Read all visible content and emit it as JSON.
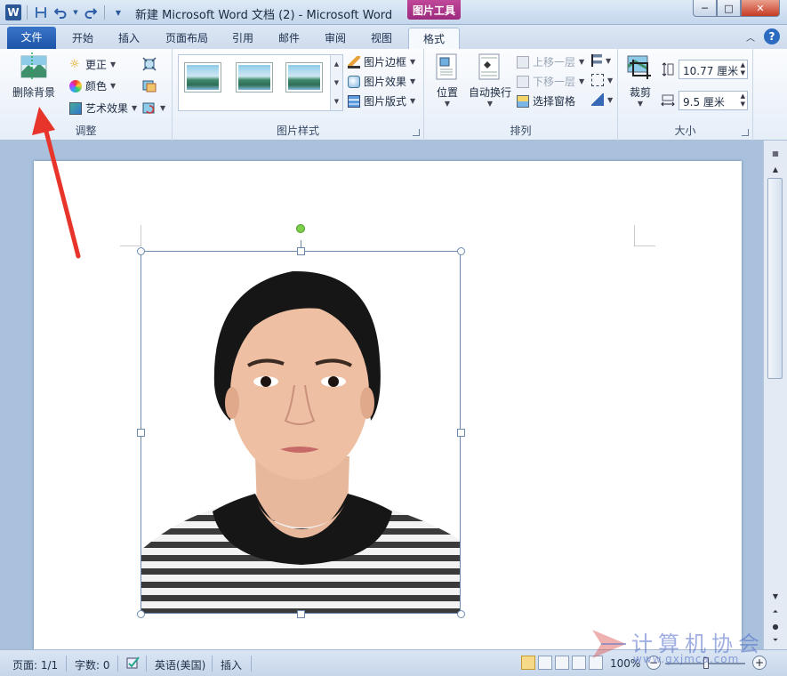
{
  "window": {
    "title": "新建 Microsoft Word 文档 (2)  -  Microsoft Word",
    "context_tab_title": "图片工具",
    "controls": {
      "minimize": "─",
      "maximize": "□",
      "close": "✕"
    }
  },
  "qat": {
    "logo": "W",
    "icons": [
      "save-icon",
      "undo-icon",
      "redo-icon",
      "customize-icon"
    ]
  },
  "tabs": [
    {
      "label": "文件",
      "kind": "file"
    },
    {
      "label": "开始"
    },
    {
      "label": "插入"
    },
    {
      "label": "页面布局"
    },
    {
      "label": "引用"
    },
    {
      "label": "邮件"
    },
    {
      "label": "审阅"
    },
    {
      "label": "视图"
    },
    {
      "label": "格式",
      "active": true
    }
  ],
  "help": "?",
  "ribbon": {
    "adjust": {
      "label": "调整",
      "remove_bg": "删除背景",
      "corrections": "更正",
      "color": "颜色",
      "artistic": "艺术效果"
    },
    "styles": {
      "label": "图片样式",
      "border": "图片边框",
      "effects": "图片效果",
      "layout": "图片版式"
    },
    "arrange": {
      "label": "排列",
      "position": "位置",
      "wrap": "自动换行",
      "bring_forward": "上移一层",
      "send_backward": "下移一层",
      "selection_pane": "选择窗格"
    },
    "size": {
      "label": "大小",
      "crop": "裁剪",
      "height": "10.77 厘米",
      "width": "9.5 厘米"
    }
  },
  "status": {
    "page": "页面: 1/1",
    "words": "字数: 0",
    "language": "英语(美国)",
    "mode": "插入",
    "zoom": "100%"
  },
  "colors": {
    "accent": "#2b5797",
    "context_tab": "#b03a8c",
    "arrow": "#e8352b"
  },
  "watermark": {
    "text": "计算机协会",
    "url": "www.gxjmca.com"
  }
}
